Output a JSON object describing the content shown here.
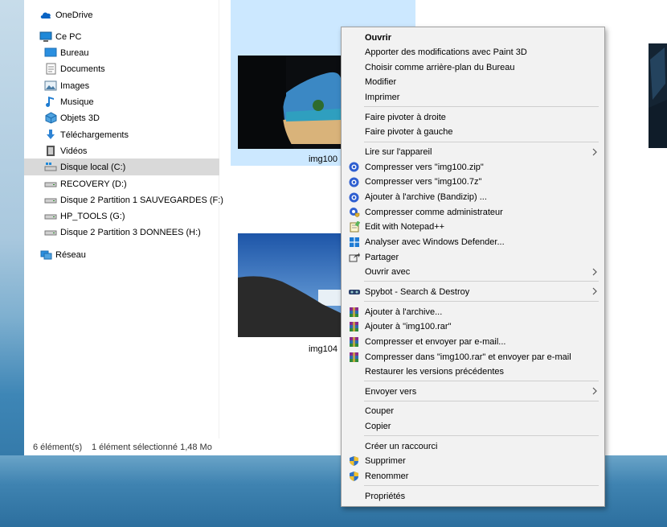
{
  "nav": {
    "items": [
      {
        "label": "OneDrive",
        "icon": "cloud-icon"
      },
      {
        "label": "Ce PC",
        "icon": "computer-icon"
      },
      {
        "label": "Bureau",
        "icon": "desktop-icon"
      },
      {
        "label": "Documents",
        "icon": "documents-icon"
      },
      {
        "label": "Images",
        "icon": "pictures-icon"
      },
      {
        "label": "Musique",
        "icon": "music-icon"
      },
      {
        "label": "Objets 3D",
        "icon": "3d-objects-icon"
      },
      {
        "label": "Téléchargements",
        "icon": "downloads-icon"
      },
      {
        "label": "Vidéos",
        "icon": "videos-icon"
      },
      {
        "label": "Disque local (C:)",
        "icon": "windows-drive-icon"
      },
      {
        "label": "RECOVERY (D:)",
        "icon": "drive-icon"
      },
      {
        "label": "Disque 2 Partition 1 SAUVEGARDES (F:)",
        "icon": "drive-icon"
      },
      {
        "label": "HP_TOOLS (G:)",
        "icon": "drive-icon"
      },
      {
        "label": "Disque 2 Partition 3 DONNEES (H:)",
        "icon": "drive-icon"
      },
      {
        "label": "Réseau",
        "icon": "network-icon"
      }
    ]
  },
  "status": {
    "count": "6 élément(s)",
    "selection": "1 élément sélectionné  1,48 Mo"
  },
  "files": [
    {
      "name": "img100",
      "selected": true
    },
    {
      "name": "img104",
      "selected": false
    }
  ],
  "context_menu": {
    "groups": [
      [
        {
          "label": "Ouvrir",
          "bold": true
        },
        {
          "label": "Apporter des modifications avec Paint 3D"
        },
        {
          "label": "Choisir comme arrière-plan du Bureau"
        },
        {
          "label": "Modifier"
        },
        {
          "label": "Imprimer"
        }
      ],
      [
        {
          "label": "Faire pivoter à droite"
        },
        {
          "label": "Faire pivoter à gauche"
        }
      ],
      [
        {
          "label": "Lire sur l'appareil",
          "submenu": true
        },
        {
          "label": "Compresser vers \"img100.zip\"",
          "icon": "bandizip-icon"
        },
        {
          "label": "Compresser vers \"img100.7z\"",
          "icon": "bandizip-icon"
        },
        {
          "label": "Ajouter à l'archive (Bandizip) ...",
          "icon": "bandizip-icon"
        },
        {
          "label": "Compresser comme administrateur",
          "icon": "bandizip-admin-icon"
        },
        {
          "label": "Edit with Notepad++",
          "icon": "notepad-plus-icon"
        },
        {
          "label": "Analyser avec Windows Defender...",
          "icon": "windows-defender-icon"
        },
        {
          "label": "Partager",
          "icon": "share-icon"
        },
        {
          "label": "Ouvrir avec",
          "submenu": true
        }
      ],
      [
        {
          "label": "Spybot - Search & Destroy",
          "icon": "spybot-icon",
          "submenu": true
        }
      ],
      [
        {
          "label": "Ajouter à l'archive...",
          "icon": "winrar-icon"
        },
        {
          "label": "Ajouter à \"img100.rar\"",
          "icon": "winrar-icon"
        },
        {
          "label": "Compresser et envoyer par e-mail...",
          "icon": "winrar-icon"
        },
        {
          "label": "Compresser dans \"img100.rar\" et envoyer par e-mail",
          "icon": "winrar-icon"
        },
        {
          "label": "Restaurer les versions précédentes"
        }
      ],
      [
        {
          "label": "Envoyer vers",
          "submenu": true
        }
      ],
      [
        {
          "label": "Couper"
        },
        {
          "label": "Copier"
        }
      ],
      [
        {
          "label": "Créer un raccourci"
        },
        {
          "label": "Supprimer",
          "icon": "shield-icon"
        },
        {
          "label": "Renommer",
          "icon": "shield-icon"
        }
      ],
      [
        {
          "label": "Propriétés"
        }
      ]
    ]
  },
  "colors": {
    "selection": "#cce8ff",
    "nav_selected": "#d9d9d9",
    "menu_bg": "#f2f2f2"
  }
}
